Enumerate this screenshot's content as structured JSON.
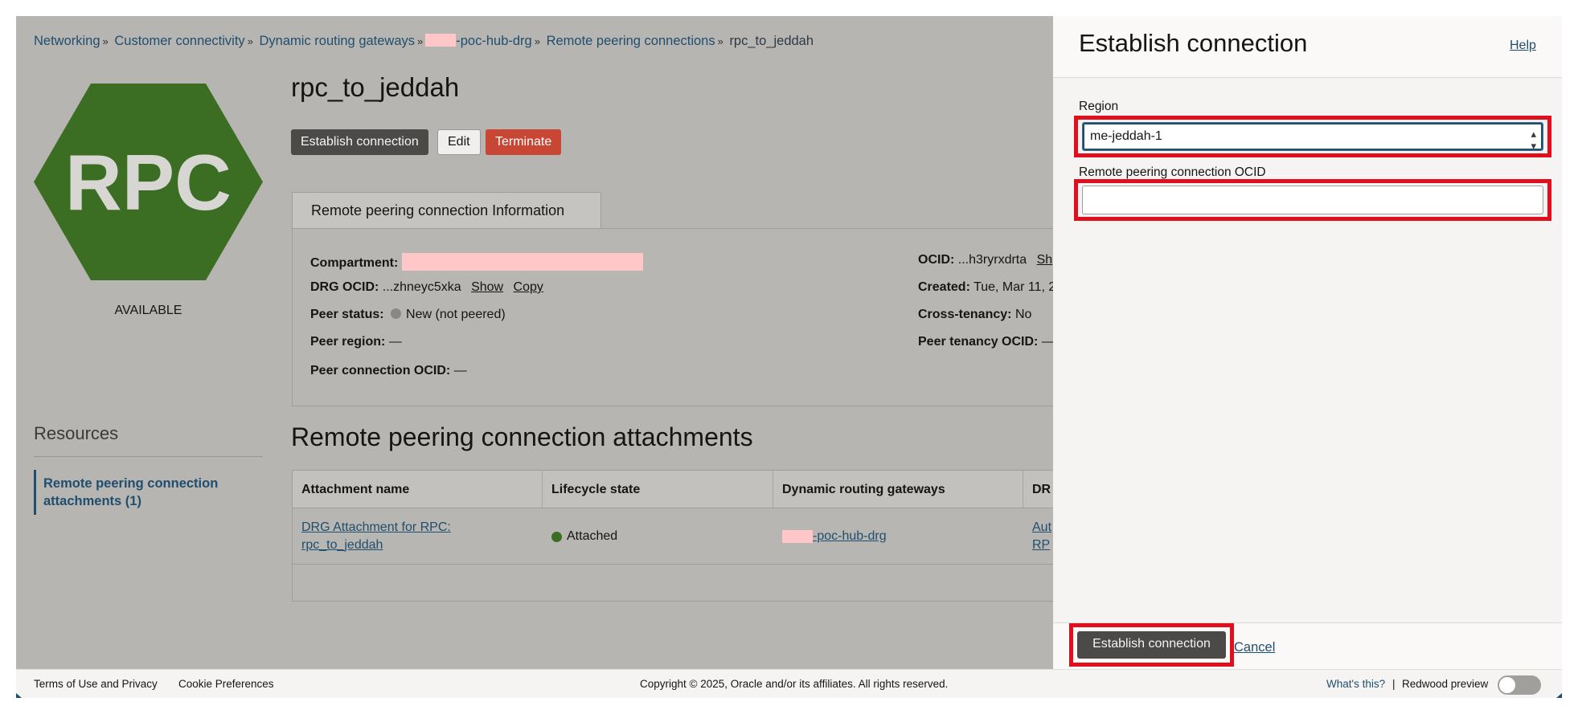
{
  "breadcrumb": {
    "items": [
      "Networking",
      "Customer connectivity",
      "Dynamic routing gateways",
      "-poc-hub-drg",
      "Remote peering connections",
      "rpc_to_jeddah"
    ],
    "separator": "»"
  },
  "hexagon": {
    "text": "RPC",
    "color": "#3b6e22",
    "status": "AVAILABLE"
  },
  "resources": {
    "title": "Resources",
    "item": "Remote peering connection attachments (1)"
  },
  "page": {
    "title": "rpc_to_jeddah"
  },
  "actions": {
    "establish": "Establish connection",
    "edit": "Edit",
    "terminate": "Terminate"
  },
  "info": {
    "tab": "Remote peering connection Information",
    "compartment_label": "Compartment:",
    "drg_ocid_label": "DRG OCID:",
    "drg_ocid_value": "...zhneyc5xka",
    "show": "Show",
    "copy": "Copy",
    "peer_status_label": "Peer status:",
    "peer_status_value": "New (not peered)",
    "peer_region_label": "Peer region:",
    "peer_region_value": "—",
    "peer_conn_ocid_label": "Peer connection OCID:",
    "peer_conn_ocid_value": "—",
    "ocid_label": "OCID:",
    "ocid_value": "...h3ryrxdrta",
    "ocid_show": "Sh",
    "created_label": "Created:",
    "created_value": "Tue, Mar 11, 2",
    "cross_tenancy_label": "Cross-tenancy:",
    "cross_tenancy_value": "No",
    "peer_tenancy_label": "Peer tenancy OCID:",
    "peer_tenancy_value": "—"
  },
  "attachments": {
    "title": "Remote peering connection attachments",
    "columns": [
      "Attachment name",
      "Lifecycle state",
      "Dynamic routing gateways",
      "DR"
    ],
    "row": {
      "name_line1": "DRG Attachment for RPC:",
      "name_line2": "rpc_to_jeddah",
      "state": "Attached",
      "drg": "-poc-hub-drg",
      "dr_line1": "Aut",
      "dr_line2": "RP"
    }
  },
  "drawer": {
    "title": "Establish connection",
    "help": "Help",
    "region_label": "Region",
    "region_value": "me-jeddah-1",
    "ocid_label": "Remote peering connection OCID",
    "ocid_value": "",
    "submit": "Establish connection",
    "cancel": "Cancel"
  },
  "footer": {
    "terms": "Terms of Use and Privacy",
    "cookies": "Cookie Preferences",
    "copyright": "Copyright © 2025, Oracle and/or its affiliates. All rights reserved.",
    "whats_this": "What's this?",
    "divider": "|",
    "redwood": "Redwood preview"
  },
  "colors": {
    "accent": "#1f4e6e",
    "danger": "#c74634",
    "highlight": "#e10f1d",
    "available_dot": "#3b6e22",
    "pending_dot": "#8a8884"
  }
}
